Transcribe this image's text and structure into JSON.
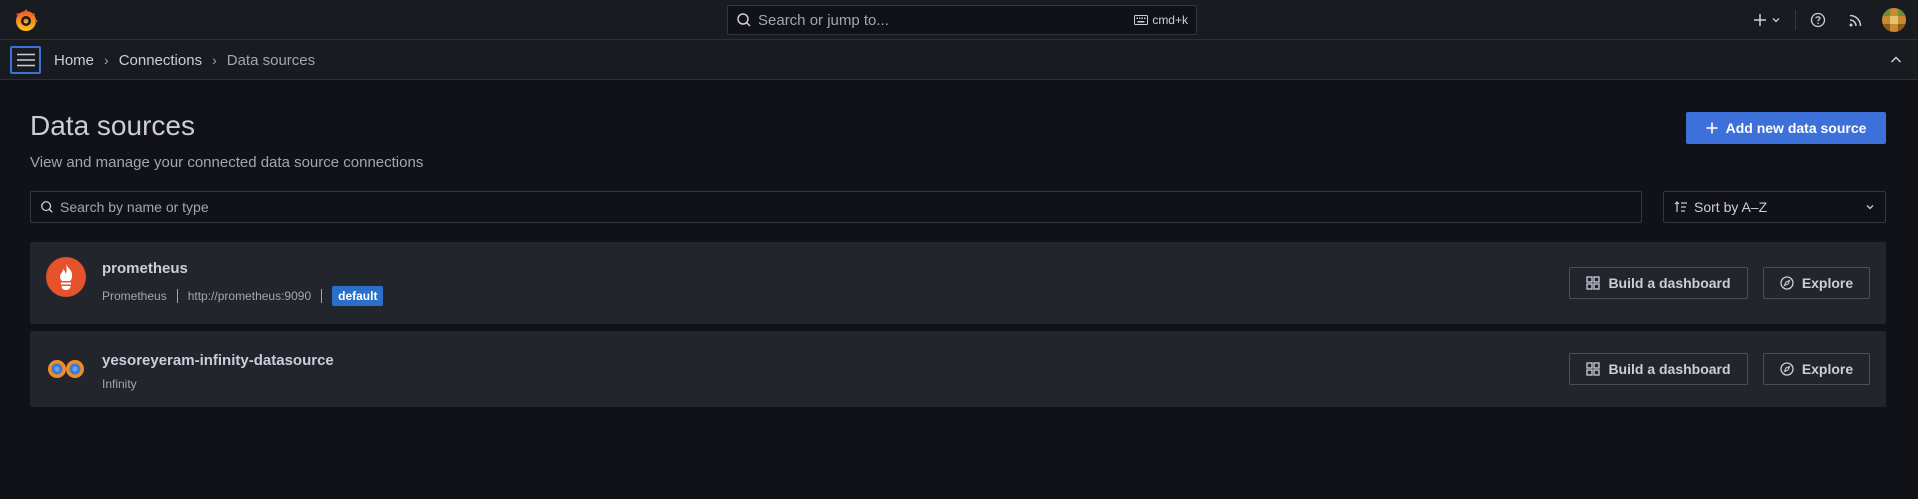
{
  "topbar": {
    "search_placeholder": "Search or jump to...",
    "shortcut": "cmd+k",
    "icons": [
      "grafana-logo-icon",
      "search-icon",
      "keyboard-icon",
      "plus-icon",
      "chevron-down-icon",
      "help-icon",
      "rss-icon",
      "avatar"
    ]
  },
  "breadcrumb": {
    "home": "Home",
    "connections": "Connections",
    "current": "Data sources"
  },
  "page": {
    "title": "Data sources",
    "subtitle": "View and manage your connected data source connections",
    "add_button": "Add new data source",
    "search_placeholder": "Search by name or type",
    "sort_label": "Sort by A–Z"
  },
  "datasources": [
    {
      "name": "prometheus",
      "type": "Prometheus",
      "url": "http://prometheus:9090",
      "badge": "default",
      "build_label": "Build a dashboard",
      "explore_label": "Explore"
    },
    {
      "name": "yesoreyeram-infinity-datasource",
      "type": "Infinity",
      "build_label": "Build a dashboard",
      "explore_label": "Explore"
    }
  ],
  "colors": {
    "background": "#111217",
    "panel": "#22252b",
    "primary": "#3d71d9",
    "badge": "#2a6fc9",
    "prometheus": "#e6522c",
    "infinity": "#f28c28"
  }
}
